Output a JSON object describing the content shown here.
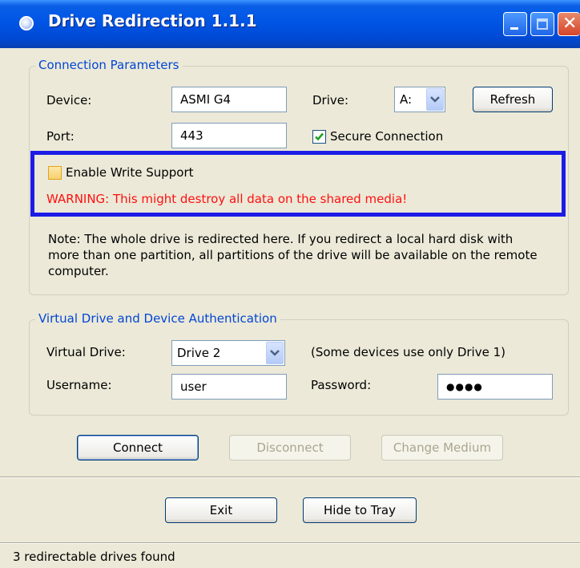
{
  "window": {
    "title": "Drive Redirection 1.1.1"
  },
  "connection": {
    "legend": "Connection Parameters",
    "device_label": "Device:",
    "device_value": "ASMI G4",
    "drive_label": "Drive:",
    "drive_value": "A:",
    "refresh_label": "Refresh",
    "port_label": "Port:",
    "port_value": "443",
    "secure_label": "Secure Connection",
    "secure_checked": true,
    "write_label": "Enable Write Support",
    "write_checked": false,
    "warning": "WARNING: This might destroy all data on the shared media!",
    "note": "Note: The whole drive is redirected here. If you redirect a local hard disk with more than one partition, all partitions of the drive will be available on the remote computer."
  },
  "virtual": {
    "legend": "Virtual Drive and Device Authentication",
    "drive_label": "Virtual Drive:",
    "drive_value": "Drive 2",
    "drive_hint": "(Some devices use only Drive 1)",
    "username_label": "Username:",
    "username_value": "user",
    "password_label": "Password:",
    "password_masked": "●●●●"
  },
  "actions": {
    "connect": "Connect",
    "disconnect": "Disconnect",
    "change_medium": "Change Medium",
    "exit": "Exit",
    "hide": "Hide to Tray"
  },
  "status": "3 redirectable drives found",
  "colors": {
    "accent": "#0046D5",
    "warning": "#FF1010",
    "highlight_border": "#1C1CE6"
  }
}
